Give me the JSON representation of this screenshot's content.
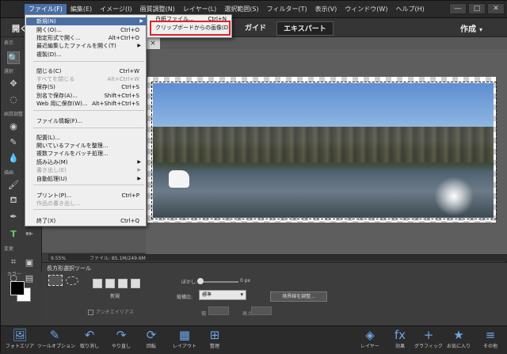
{
  "menubar": [
    "ファイル(F)",
    "編集(E)",
    "イメージ(I)",
    "画質調整(N)",
    "レイヤー(L)",
    "選択範囲(S)",
    "フィルター(T)",
    "表示(V)",
    "ウィンドウ(W)",
    "ヘルプ(H)"
  ],
  "window_controls": [
    "―",
    "□",
    "✕"
  ],
  "toolbar": {
    "open_label": "開く",
    "mode_guide": "ガイド",
    "mode_expert": "エキスパート",
    "create": "作成"
  },
  "document_tab": {
    "close": "×"
  },
  "tool_sections": {
    "view": "表示",
    "select": "選択",
    "enhance": "画質調整",
    "draw": "描画",
    "modify": "変更",
    "color": "カラー"
  },
  "file_menu": {
    "items": [
      {
        "label": "新規(N)",
        "shortcut": "",
        "submenu": true,
        "highlighted": true,
        "disabled": false
      },
      {
        "label": "開く(O)...",
        "shortcut": "Ctrl+O"
      },
      {
        "label": "指定形式で開く...",
        "shortcut": "Alt+Ctrl+O"
      },
      {
        "label": "最近編集したファイルを開く(T)",
        "shortcut": "",
        "submenu": true
      },
      {
        "label": "複製(D)...",
        "shortcut": ""
      },
      {
        "label": "閉じる(C)",
        "shortcut": "Ctrl+W"
      },
      {
        "label": "すべてを閉じる",
        "shortcut": "Alt+Ctrl+W",
        "disabled": true
      },
      {
        "label": "保存(S)",
        "shortcut": "Ctrl+S"
      },
      {
        "label": "別名で保存(A)...",
        "shortcut": "Shift+Ctrl+S"
      },
      {
        "label": "Web 用に保存(W)...",
        "shortcut": "Alt+Shift+Ctrl+S"
      },
      {
        "label": "ファイル情報(F)...",
        "shortcut": ""
      },
      {
        "label": "配置(L)...",
        "shortcut": ""
      },
      {
        "label": "開いているファイルを整理...",
        "shortcut": ""
      },
      {
        "label": "複数ファイルをバッチ処理...",
        "shortcut": ""
      },
      {
        "label": "読み込み(M)",
        "shortcut": "",
        "submenu": true
      },
      {
        "label": "書き出し(E)",
        "shortcut": "",
        "submenu": true,
        "disabled": true
      },
      {
        "label": "自動処理(U)",
        "shortcut": "",
        "submenu": true
      },
      {
        "label": "プリント(P)...",
        "shortcut": "Ctrl+P"
      },
      {
        "label": "作品の書き出し...",
        "shortcut": "",
        "disabled": true
      },
      {
        "label": "終了(X)",
        "shortcut": "Ctrl+Q"
      }
    ]
  },
  "new_submenu": {
    "items": [
      {
        "label": "白紙ファイル...",
        "shortcut": "Ctrl+N"
      },
      {
        "label": "クリップボードからの画像(D)",
        "shortcut": "",
        "outlined": true
      }
    ]
  },
  "status_bar": {
    "zoom": "9.55%",
    "file": "ファイル: 85.1M/249.6M"
  },
  "tool_options": {
    "title": "長方形選択ツール",
    "new_label": "新規",
    "antialias": "アンチエイリアス",
    "feather_label": "ぼかし:",
    "feather_value": "0 px",
    "aspect_label": "縦横比:",
    "aspect_value": "標準",
    "width_label": "幅",
    "height_label": "高さ",
    "refine_edge": "境界線を調整..."
  },
  "bottom_bar": {
    "left": [
      {
        "label": "フォトエリア",
        "icon": "photo-bin-icon"
      },
      {
        "label": "ツールオプション",
        "icon": "tool-options-icon"
      },
      {
        "label": "取り消し",
        "icon": "undo-icon"
      },
      {
        "label": "やり直し",
        "icon": "redo-icon"
      },
      {
        "label": "回転",
        "icon": "rotate-icon"
      },
      {
        "label": "レイアウト",
        "icon": "layout-icon"
      },
      {
        "label": "整理",
        "icon": "organizer-icon"
      }
    ],
    "right": [
      {
        "label": "レイヤー",
        "icon": "layers-icon"
      },
      {
        "label": "効果",
        "icon": "fx-icon"
      },
      {
        "label": "グラフィック",
        "icon": "graphics-icon"
      },
      {
        "label": "お気に入り",
        "icon": "favorites-icon"
      },
      {
        "label": "その他",
        "icon": "more-icon"
      }
    ]
  },
  "colors": {
    "menu_highlight": "#4a6fa5",
    "callout_outline": "#e0202a",
    "accent_icon": "#6aa6e8"
  }
}
